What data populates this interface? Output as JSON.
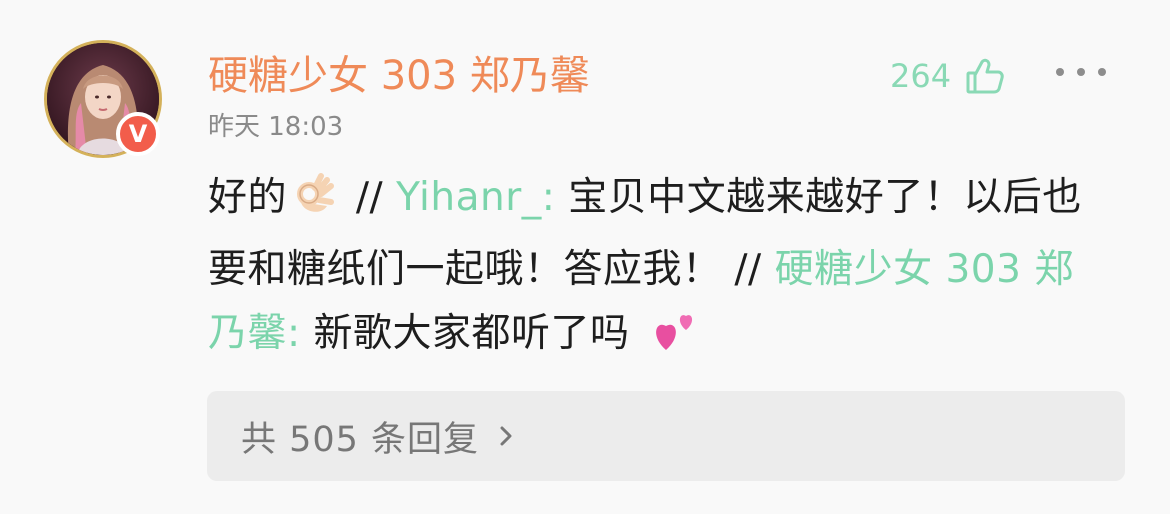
{
  "comment": {
    "username": "硬糖少女 303 郑乃馨",
    "timestamp": "昨天 18:03",
    "likes": "264",
    "verified_label": "V",
    "content": {
      "text1": "好的",
      "emoji1": "ok-hand-emoji",
      "sep1": " // ",
      "mention1": "Yihanr_:",
      "text2": " 宝贝中文越来越好了！以后也要和糖纸们一起哦！答应我！ ",
      "sep2": "// ",
      "mention2": "硬糖少女 303 郑乃馨:",
      "text3": " 新歌大家都听了吗 ",
      "emoji2": "two-hearts-emoji"
    },
    "replies_label": "共 505 条回复"
  },
  "colors": {
    "username": "#ef8a58",
    "mention": "#7bd4ab",
    "likes": "#8ad9b5",
    "badge": "#f25d4b",
    "avatar_ring": "#d4b15a",
    "reply_box": "#ececec"
  },
  "icons": {
    "like": "thumbs-up-icon",
    "more": "more-dots-icon",
    "chevron": "chevron-right-icon",
    "verified": "verified-badge-icon"
  }
}
